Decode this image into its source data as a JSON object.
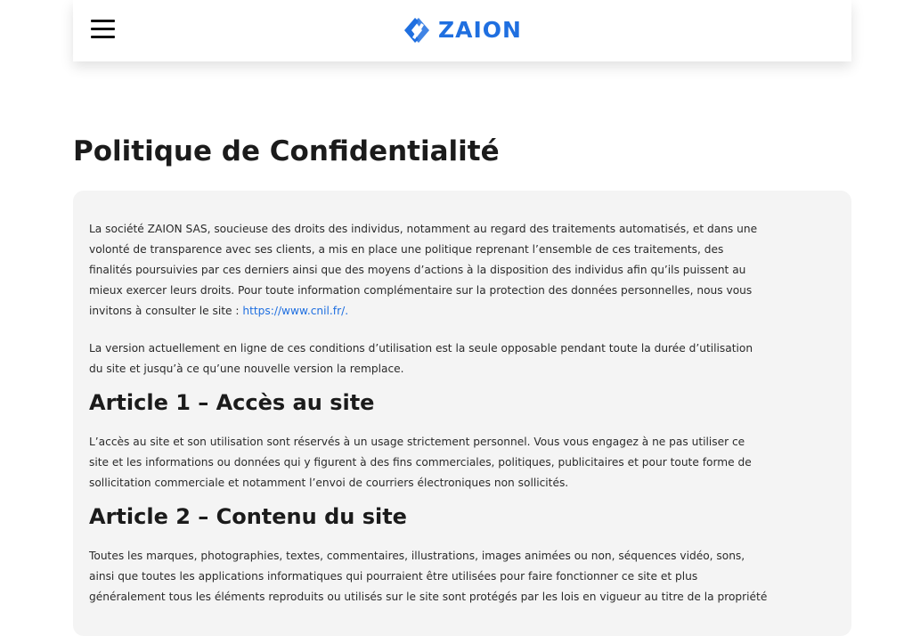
{
  "header": {
    "logo_text": "ZAION",
    "brand_color": "#1f6fe0"
  },
  "page": {
    "title": "Politique de Confidentialité"
  },
  "intro": {
    "lines": [
      "La société ZAION SAS, soucieuse des droits des individus, notamment au regard des traitements automatisés, et dans une",
      "volonté de transparence avec ses clients, a mis en place une politique reprenant l’ensemble de ces traitements, des",
      "finalités poursuivies par ces derniers ainsi que des moyens d’actions à la disposition des individus afin qu’ils puissent au",
      "mieux exercer leurs droits. Pour toute information complémentaire sur la protection des données personnelles, nous vous"
    ],
    "last_line_prefix": "invitons à consulter le site : ",
    "link_text": "https://www.cnil.fr/."
  },
  "version_notice": {
    "lines": [
      "La version actuellement en ligne de ces conditions d’utilisation est la seule opposable pendant toute la durée d’utilisation",
      "du site et jusqu’à ce qu’une nouvelle version la remplace."
    ]
  },
  "article1": {
    "title": "Article 1 – Accès au site",
    "lines": [
      "L’accès au site et son utilisation sont réservés à un usage strictement personnel. Vous vous engagez à ne pas utiliser ce",
      "site et les informations ou données qui y figurent à des fins commerciales, politiques, publicitaires et pour toute forme de",
      "sollicitation commerciale et notamment l’envoi de courriers électroniques non sollicités."
    ]
  },
  "article2": {
    "title": "Article 2 – Contenu du site",
    "lines": [
      "Toutes les marques, photographies, textes, commentaires, illustrations, images animées ou non, séquences vidéo, sons,",
      "ainsi que toutes les applications informatiques qui pourraient être utilisées pour faire fonctionner ce site et plus",
      "généralement tous les éléments reproduits ou utilisés sur le site sont protégés par les lois en vigueur au titre de la propriété"
    ]
  }
}
